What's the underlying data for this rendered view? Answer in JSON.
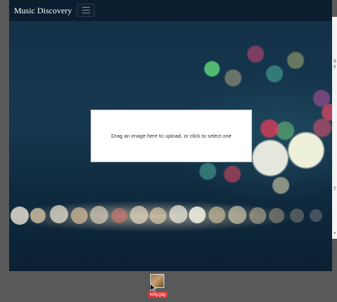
{
  "app": {
    "title": "Music Discovery"
  },
  "upload": {
    "prompt": "Drag an image here to upload, or click to select one"
  },
  "drag": {
    "file_name": "kitty.jpg"
  },
  "background_window": {
    "glyphs": [
      "S",
      "y",
      "T",
      "•"
    ]
  },
  "colors": {
    "navbar": "#0b1e2f",
    "desktop": "#595959",
    "drag_label": "#d93a3a"
  }
}
